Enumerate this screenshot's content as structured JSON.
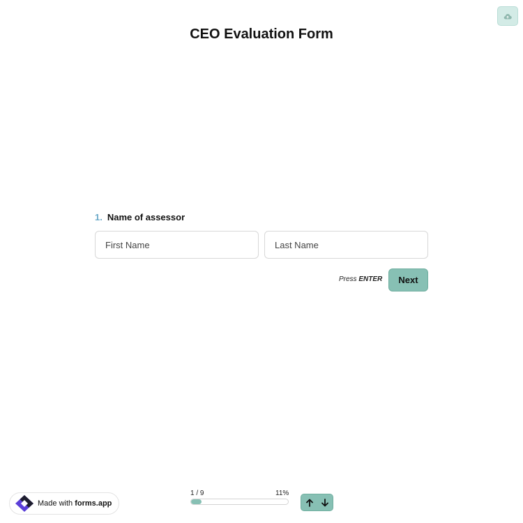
{
  "form": {
    "title": "CEO Evaluation Form"
  },
  "question": {
    "number": "1.",
    "label": "Name of assessor",
    "first_name": {
      "placeholder": "First Name",
      "value": ""
    },
    "last_name": {
      "placeholder": "Last Name",
      "value": ""
    }
  },
  "actions": {
    "hint_prefix": "Press ",
    "hint_key": "ENTER",
    "next_label": "Next"
  },
  "footer": {
    "badge_prefix": "Made with ",
    "badge_brand": "forms.app",
    "progress_count": "1 / 9",
    "progress_percent": "11%",
    "progress_value": 0.11
  },
  "icons": {
    "save": "cloud-upload-icon",
    "logo": "forms-app-logo-icon",
    "up": "arrow-up-icon",
    "down": "arrow-down-icon"
  },
  "colors": {
    "accent": "#87c0b4",
    "accent_light": "#d3ebe6",
    "question_number": "#6aa9c8"
  }
}
